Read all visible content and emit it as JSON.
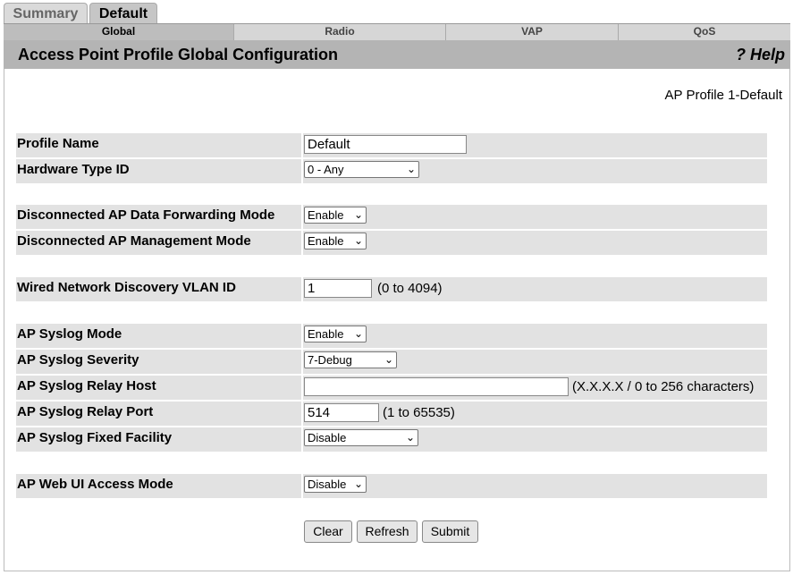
{
  "top_tabs": [
    {
      "label": "Summary"
    },
    {
      "label": "Default"
    }
  ],
  "sub_tabs": [
    {
      "label": "Global"
    },
    {
      "label": "Radio"
    },
    {
      "label": "VAP"
    },
    {
      "label": "QoS"
    }
  ],
  "header": {
    "title": "Access Point Profile Global Configuration",
    "help": "? Help"
  },
  "profile_label": "AP Profile 1-Default",
  "fields": {
    "profile_name": {
      "label": "Profile Name",
      "value": "Default"
    },
    "hardware_type": {
      "label": "Hardware Type ID",
      "value": "0 - Any"
    },
    "disc_forwarding": {
      "label": "Disconnected AP Data Forwarding Mode",
      "value": "Enable"
    },
    "disc_management": {
      "label": "Disconnected AP Management Mode",
      "value": "Enable"
    },
    "vlan_id": {
      "label": "Wired Network Discovery VLAN ID",
      "value": "1",
      "hint": "(0 to 4094)"
    },
    "syslog_mode": {
      "label": "AP Syslog Mode",
      "value": "Enable"
    },
    "syslog_severity": {
      "label": "AP Syslog Severity",
      "value": "7-Debug"
    },
    "syslog_relay_host": {
      "label": "AP Syslog Relay Host",
      "value": "",
      "hint": "(X.X.X.X / 0 to 256 characters)"
    },
    "syslog_relay_port": {
      "label": "AP Syslog Relay Port",
      "value": "514",
      "hint": "(1 to 65535)"
    },
    "syslog_facility": {
      "label": "AP Syslog Fixed Facility",
      "value": "Disable"
    },
    "web_ui_access": {
      "label": "AP Web UI Access Mode",
      "value": "Disable"
    }
  },
  "buttons": {
    "clear": "Clear",
    "refresh": "Refresh",
    "submit": "Submit"
  }
}
